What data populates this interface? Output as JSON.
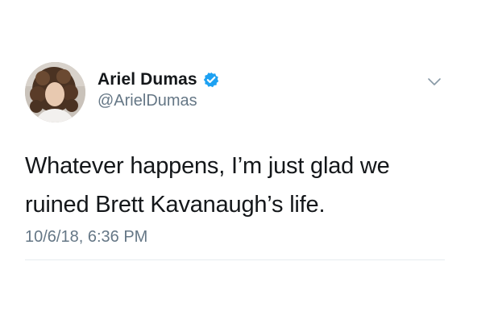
{
  "tweet": {
    "author": {
      "display_name": "Ariel Dumas",
      "handle": "@ArielDumas",
      "verified": true,
      "avatar_icon": "profile-photo"
    },
    "text_lines": [
      "Whatever happens, I’m just glad we",
      "ruined Brett Kavanaugh’s life."
    ],
    "timestamp": "10/6/18, 6:36 PM",
    "menu_icon": "chevron-down-icon"
  },
  "colors": {
    "name": "#14171a",
    "secondary": "#657786",
    "verified_badge": "#1da1f2",
    "divider": "#e6ecf0"
  }
}
